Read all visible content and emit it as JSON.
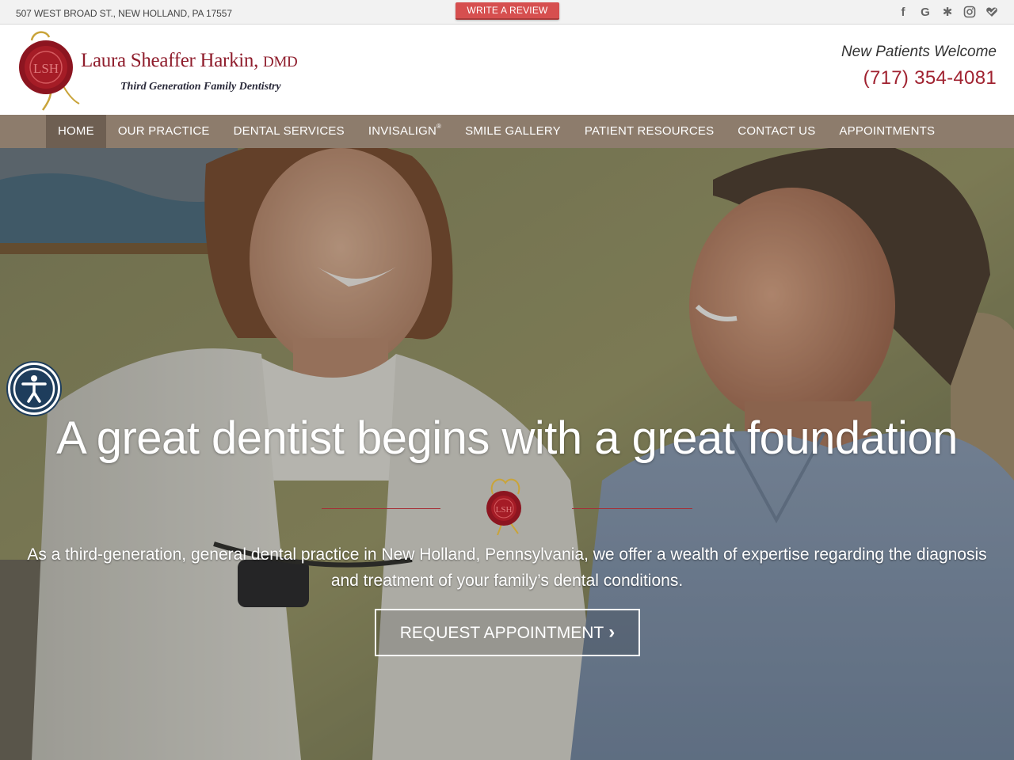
{
  "topbar": {
    "address": "507 WEST BROAD ST., NEW HOLLAND, PA 17557",
    "review_label": "WRITE A REVIEW",
    "socials": [
      {
        "icon": "facebook-icon",
        "glyph": "f"
      },
      {
        "icon": "google-icon",
        "glyph": "G"
      },
      {
        "icon": "yelp-icon",
        "glyph": "✱"
      },
      {
        "icon": "instagram-icon",
        "glyph": ""
      },
      {
        "icon": "healthgrades-icon",
        "glyph": ""
      }
    ]
  },
  "header": {
    "logo_seal_text": "LSH",
    "practice_name": "Laura Sheaffer Harkin,",
    "practice_suffix": "DMD",
    "tagline": "Third Generation Family Dentistry",
    "welcome": "New Patients Welcome",
    "phone": "(717) 354-4081"
  },
  "nav": {
    "items": [
      {
        "label": "HOME",
        "active": true
      },
      {
        "label": "OUR PRACTICE",
        "active": false
      },
      {
        "label": "DENTAL SERVICES",
        "active": false
      },
      {
        "label": "INVISALIGN",
        "active": false,
        "sup": "®"
      },
      {
        "label": "SMILE GALLERY",
        "active": false
      },
      {
        "label": "PATIENT RESOURCES",
        "active": false
      },
      {
        "label": "CONTACT US",
        "active": false
      },
      {
        "label": "APPOINTMENTS",
        "active": false
      }
    ]
  },
  "hero": {
    "title": "A great dentist begins with a great foundation",
    "text": "As a third-generation, general dental practice in New Holland, Pennsylvania, we offer a wealth of expertise regarding the diagnosis and treatment of your family’s dental conditions.",
    "cta_label": "REQUEST APPOINTMENT",
    "cta_chevron": "›"
  },
  "colors": {
    "brand_red": "#a02230",
    "nav_bg": "#8d7c6c",
    "nav_active": "#6e5f52",
    "review_btn": "#d64f4f",
    "access_btn": "#1e3d5c"
  }
}
